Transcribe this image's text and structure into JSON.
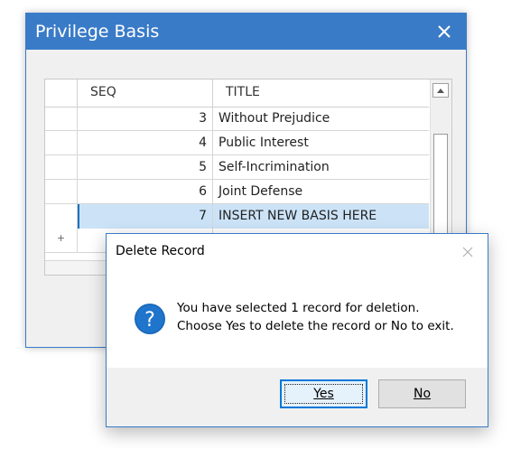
{
  "main_window": {
    "title": "Privilege Basis",
    "accent_color": "#3a7bc8",
    "close_icon": "close-icon"
  },
  "grid": {
    "columns": [
      "SEQ",
      "TITLE"
    ],
    "rows": [
      {
        "seq": "3",
        "title": "Without Prejudice",
        "selected": false
      },
      {
        "seq": "4",
        "title": "Public Interest",
        "selected": false
      },
      {
        "seq": "5",
        "title": "Self-Incrimination",
        "selected": false
      },
      {
        "seq": "6",
        "title": "Joint Defense",
        "selected": false
      },
      {
        "seq": "7",
        "title": "INSERT NEW BASIS HERE",
        "selected": true
      }
    ],
    "new_row_marker": "+",
    "selected_row_color": "#cce3f7"
  },
  "dialog": {
    "title": "Delete Record",
    "icon": "question-icon",
    "message_line1": "You have selected 1 record for deletion.",
    "message_line2": "Choose Yes to delete the record or No to exit.",
    "yes_label": "Yes",
    "no_label": "No"
  }
}
